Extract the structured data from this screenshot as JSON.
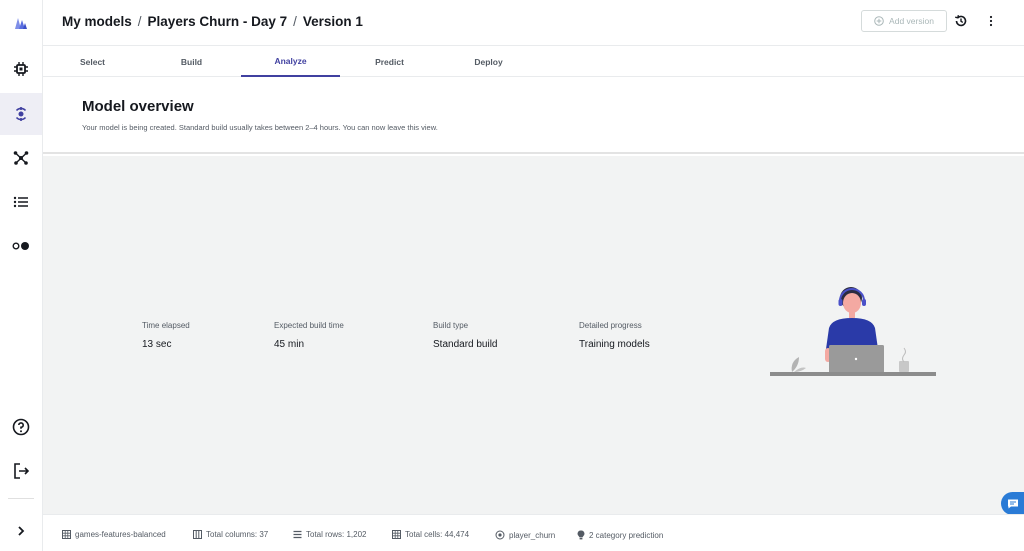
{
  "header": {
    "breadcrumb": [
      "My models",
      "Players Churn - Day 7",
      "Version 1"
    ],
    "separator": "/",
    "add_version_label": "Add version"
  },
  "tabs": [
    {
      "label": "Select"
    },
    {
      "label": "Build"
    },
    {
      "label": "Analyze",
      "active": true
    },
    {
      "label": "Predict"
    },
    {
      "label": "Deploy"
    }
  ],
  "overview": {
    "title": "Model overview",
    "subtitle": "Your model is being created. Standard build usually takes between 2–4 hours. You can now leave this view."
  },
  "stats": [
    {
      "label": "Time elapsed",
      "value": "13 sec"
    },
    {
      "label": "Expected build time",
      "value": "45 min"
    },
    {
      "label": "Build type",
      "value": "Standard build"
    },
    {
      "label": "Detailed progress",
      "value": "Training models"
    }
  ],
  "footer": {
    "dataset": "games-features-balanced",
    "total_columns": "Total columns: 37",
    "total_rows": "Total rows: 1,202",
    "total_cells": "Total cells: 44,474",
    "target": "player_churn",
    "prediction_type": "2 category prediction"
  },
  "colors": {
    "accent": "#4040a0",
    "logo": "#5a6ee0",
    "background": "#f2f3f3",
    "chat": "#2a7bd6"
  },
  "icons": {
    "rail": [
      "canvas-logo-icon",
      "chip-icon",
      "model-icon",
      "nodes-icon",
      "list-icon",
      "toggle-icon",
      "help-icon",
      "sign-out-icon",
      "chevron-right-icon"
    ]
  }
}
